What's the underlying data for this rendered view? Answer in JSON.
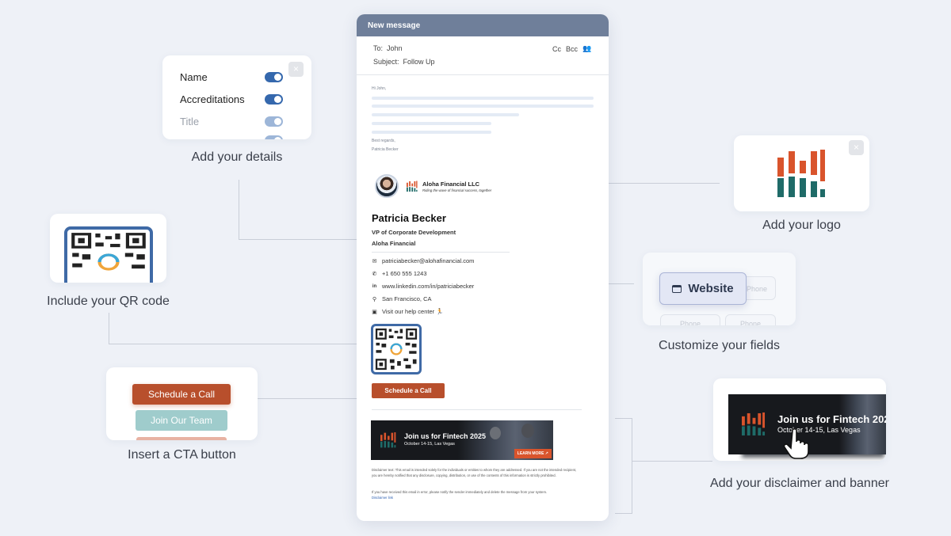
{
  "email": {
    "window_title": "New message",
    "to_label": "To:",
    "to_value": "John",
    "subject_label": "Subject:",
    "subject_value": "Follow Up",
    "cc_label": "Cc",
    "bcc_label": "Bcc",
    "greeting": "Hi John,",
    "signoff": "Best regards,",
    "signoff_name": "Patricia Becker"
  },
  "signature": {
    "company": "Aloha Financial LLC",
    "tagline": "Riding the wave of financial success, together",
    "name": "Patricia Becker",
    "title": "VP of Corporate Development",
    "org": "Aloha Financial",
    "contacts": [
      {
        "icon": "email-icon",
        "glyph": "✉",
        "text": "patriciabecker@alohafinancial.com"
      },
      {
        "icon": "phone-icon",
        "glyph": "✆",
        "text": "+1 650 555 1243"
      },
      {
        "icon": "linkedin-icon",
        "glyph": "in",
        "text": "www.linkedin.com/in/patriciabecker"
      },
      {
        "icon": "location-pin-icon",
        "glyph": "⚲",
        "text": "San Francisco, CA"
      },
      {
        "icon": "help-center-icon",
        "glyph": "▣",
        "text": "Visit our help center 🏃"
      }
    ],
    "cta_label": "Schedule a Call",
    "banner_title": "Join us for Fintech 2025",
    "banner_subtitle": "October 14-15, Las Vegas",
    "banner_button": "LEARN MORE ↗",
    "disclaimer_1": "Disclaimer text: This email is intended solely for the individuals or entities to whom they are addressed. If you are not the intended recipient, you are hereby notified that any disclosure, copying, distribution, or use of the contents of this information is strictly prohibited.",
    "disclaimer_2": "If you have received this email in error, please notify the sender immediately and delete the message from your system.",
    "disclaimer_link": "Disclaimer link"
  },
  "features": {
    "details": {
      "caption": "Add your details",
      "close": "×",
      "fields": [
        {
          "label": "Name",
          "enabled": true
        },
        {
          "label": "Accreditations",
          "enabled": true
        },
        {
          "label": "Title",
          "enabled": true,
          "faded": true
        }
      ]
    },
    "qr": {
      "caption": "Include your QR code"
    },
    "cta": {
      "caption": "Insert a CTA button",
      "buttons": [
        "Schedule a Call",
        "Join Our Team"
      ]
    },
    "logo": {
      "caption": "Add your logo",
      "close": "×"
    },
    "fields": {
      "caption": "Customize your fields",
      "active_field": "Website",
      "ghost_fields": [
        "Phone",
        "Phone",
        "Phone"
      ]
    },
    "banner": {
      "caption": "Add your disclaimer and banner",
      "title": "Join us for Fintech 202",
      "subtitle": "October 14-15, Las Vegas"
    }
  },
  "colors": {
    "accent_blue": "#3568ad",
    "cta_orange": "#b84f2c",
    "header_slate": "#6f7f9a",
    "logo_orange": "#d9542c",
    "logo_teal": "#1f6b68",
    "teal_button": "#8fc4c4"
  }
}
